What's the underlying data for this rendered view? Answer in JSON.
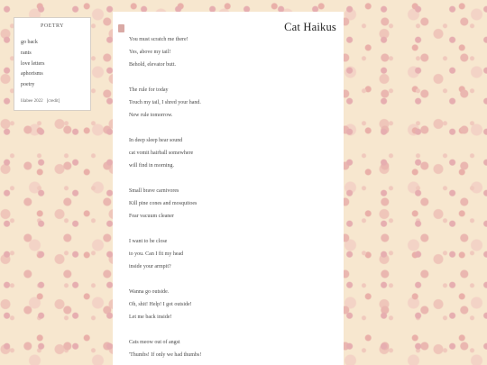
{
  "sidebar": {
    "title": "POETRY",
    "nav": [
      "go back",
      "rants",
      "love letters",
      "aphorisms",
      "poetry"
    ],
    "footer": {
      "copyright": "lilabee 2022",
      "credit": "[credit]"
    }
  },
  "main": {
    "title": "Cat Haikus",
    "stanzas": [
      [
        "You must scratch me there!",
        "Yes, above my tail!",
        "Behold, elevator butt."
      ],
      [
        "The rule for today",
        "Touch my tail, I shred your hand.",
        "New rule tomorrow."
      ],
      [
        "In deep sleep hear sound",
        "cat vomit hairball somewhere",
        "will find in morning."
      ],
      [
        "Small brave carnivores",
        "Kill pine cones and mosquitoes",
        "Fear vacuum cleaner"
      ],
      [
        "I want to be close",
        "to you. Can I fit my head",
        "inside your armpit?"
      ],
      [
        "Wanna go outside.",
        "Oh, shit! Help! I got outside!",
        "Let me back inside!"
      ],
      [
        "Cats meow out of angst",
        "'Thumbs! If only we had thumbs!"
      ]
    ]
  },
  "colors": {
    "card": "#ffffff",
    "bookmark": "#d9a9a5",
    "wallpaper": "#f7e7cf"
  }
}
